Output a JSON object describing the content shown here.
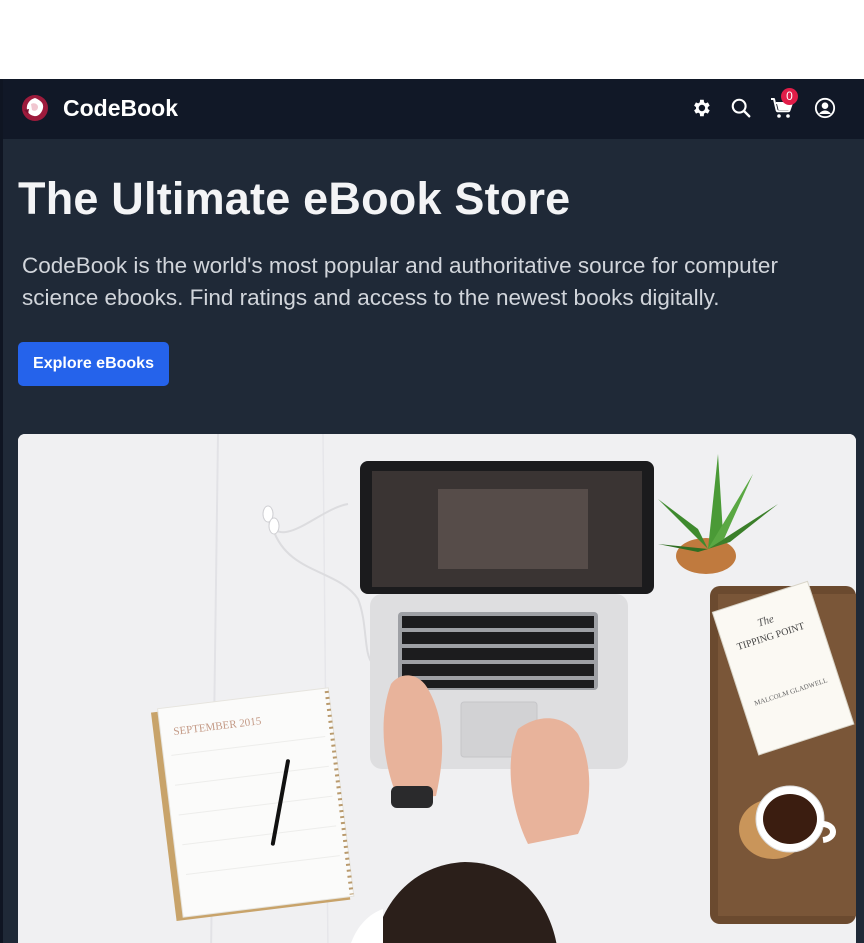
{
  "navbar": {
    "brand": "CodeBook",
    "icons": {
      "logo": "rose-logo-icon",
      "settings": "gear-icon",
      "search": "search-icon",
      "cart": "cart-icon",
      "account": "user-circle-icon"
    },
    "cart_count": "0"
  },
  "hero": {
    "title": "The Ultimate eBook Store",
    "description": "CodeBook is the world's most popular and authoritative source for computer science ebooks. Find ratings and access to the newest books digitally.",
    "cta_label": "Explore eBooks",
    "image_alt": "Person typing on a laptop at a white desk with a notebook, plant, coffee and a book",
    "image_text": {
      "notebook": "SEPTEMBER 2015",
      "book_line1": "The",
      "book_line2": "TIPPING POINT",
      "book_author": "MALCOLM GLADWELL"
    }
  },
  "colors": {
    "page_bg": "#1f2937",
    "nav_bg": "#111827",
    "accent": "#2563eb",
    "badge": "#e11d48",
    "title": "#f3f4f6",
    "body_text": "#d1d5db"
  }
}
